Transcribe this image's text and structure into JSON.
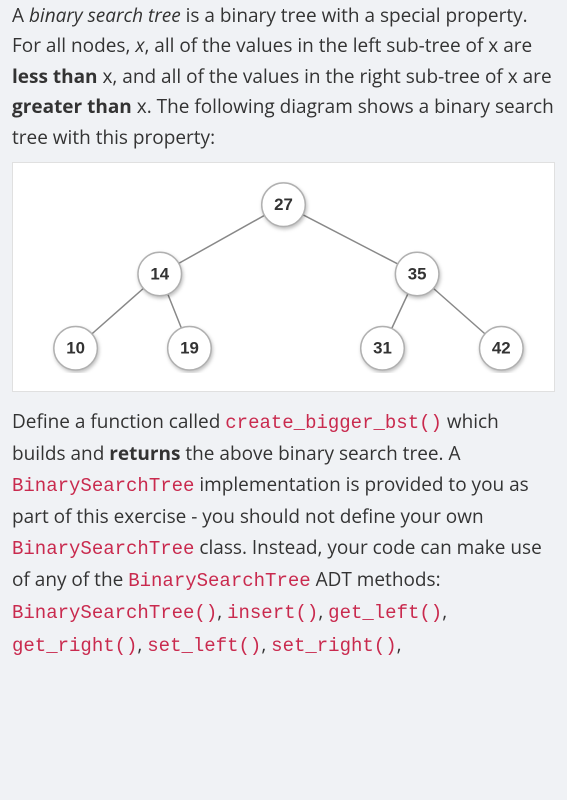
{
  "intro": {
    "s1a": "A ",
    "s1_italic": "binary search tree",
    "s1b": " is a binary tree with a special property.  For all nodes, ",
    "s1_x": "x",
    "s1c": ", all of the values in the left sub-tree of x are ",
    "s1_less": "less than",
    "s1d": " x, and all of the values in the right sub-tree of x are ",
    "s1_greater": "greater than",
    "s1e": "  x.  The following diagram shows a binary search tree with this property:"
  },
  "tree": {
    "root": "27",
    "left": "14",
    "right": "35",
    "ll": "10",
    "lr": "19",
    "rl": "31",
    "rr": "42"
  },
  "body": {
    "p1a": "Define a function called ",
    "p1_code1": "create_bigger_bst()",
    "p1b": " which builds and ",
    "p1_returns": "returns",
    "p1c": " the above binary search tree. A ",
    "p1_code2": "BinarySearchTree",
    "p1d": " implementation is provided to you as part of this exercise - you should not define your own ",
    "p1_code3": "BinarySearchTree",
    "p1e": " class. Instead, your code can make use of any of the ",
    "p1_code4": "BinarySearchTree",
    "p1f": " ADT methods: ",
    "m1": "BinarySearchTree()",
    "sep": ", ",
    "m2": "insert()",
    "m3": "get_left()",
    "m4": "get_right()",
    "m5": "set_left()",
    "m6": "set_right()",
    "trail": ","
  }
}
